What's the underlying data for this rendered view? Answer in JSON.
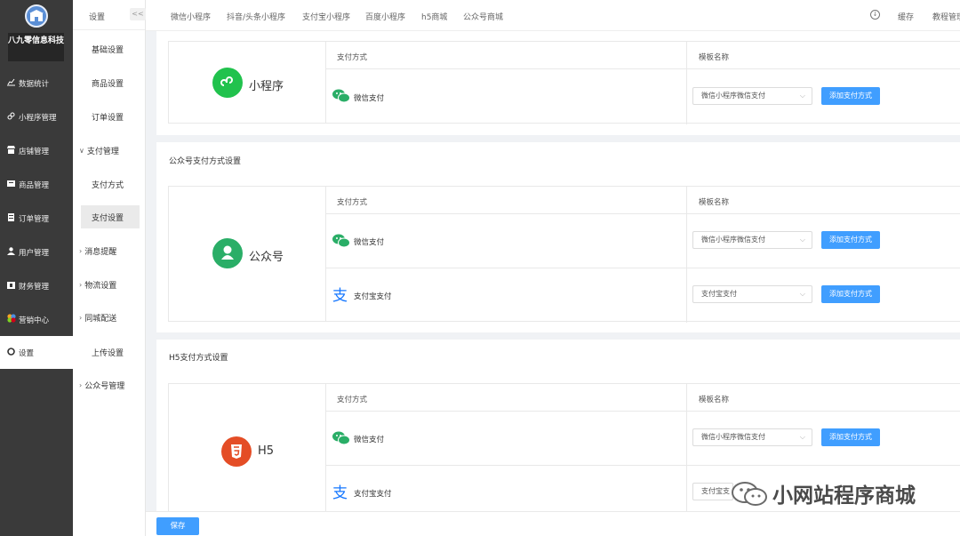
{
  "sidebar": {
    "brand": "八九零信息科技",
    "items": [
      {
        "icon": "chart-icon",
        "label": "数据统计"
      },
      {
        "icon": "link-icon",
        "label": "小程序管理"
      },
      {
        "icon": "store-icon",
        "label": "店铺管理"
      },
      {
        "icon": "goods-icon",
        "label": "商品管理"
      },
      {
        "icon": "order-icon",
        "label": "订单管理"
      },
      {
        "icon": "user-icon",
        "label": "用户管理"
      },
      {
        "icon": "finance-icon",
        "label": "财务管理"
      },
      {
        "icon": "marketing-icon",
        "label": "营销中心"
      },
      {
        "icon": "settings-icon",
        "label": "设置"
      }
    ]
  },
  "subnav": {
    "title": "设置",
    "collapse": "<<",
    "items": [
      {
        "label": "基础设置"
      },
      {
        "label": "商品设置"
      },
      {
        "label": "订单设置"
      },
      {
        "label": "支付管理"
      },
      {
        "label": "支付方式"
      },
      {
        "label": "支付设置"
      },
      {
        "label": "消息提醒"
      },
      {
        "label": "物流设置"
      },
      {
        "label": "同城配送"
      },
      {
        "label": "上传设置"
      },
      {
        "label": "公众号管理"
      }
    ]
  },
  "topbar": {
    "tabs": [
      "微信小程序",
      "抖音/头条小程序",
      "支付宝小程序",
      "百度小程序",
      "h5商城",
      "公众号商城"
    ],
    "cache": "缓存",
    "tutorial": "教程管理"
  },
  "table_headers": {
    "pay_method": "支付方式",
    "template_name": "模板名称"
  },
  "sections": {
    "miniprogram": {
      "platform": "小程序",
      "rows": [
        {
          "pay": "微信支付",
          "template": "微信小程序微信支付",
          "button": "添加支付方式"
        }
      ]
    },
    "official": {
      "title": "公众号支付方式设置",
      "platform": "公众号",
      "rows": [
        {
          "pay": "微信支付",
          "template": "微信小程序微信支付",
          "button": "添加支付方式"
        },
        {
          "pay": "支付宝支付",
          "template": "支付宝支付",
          "button": "添加支付方式"
        }
      ]
    },
    "h5": {
      "title": "H5支付方式设置",
      "platform": "H5",
      "rows": [
        {
          "pay": "微信支付",
          "template": "微信小程序微信支付",
          "button": "添加支付方式"
        },
        {
          "pay": "支付宝支付",
          "template": "支付宝支付"
        }
      ]
    }
  },
  "footer": {
    "save": "保存"
  },
  "watermark": "小网站程序商城",
  "colors": {
    "primary": "#409eff",
    "wechat": "#2aae67",
    "mini": "#21c24d",
    "h5": "#e44d26",
    "alipay": "#1677ff",
    "sidebar": "#3a3a3a"
  }
}
